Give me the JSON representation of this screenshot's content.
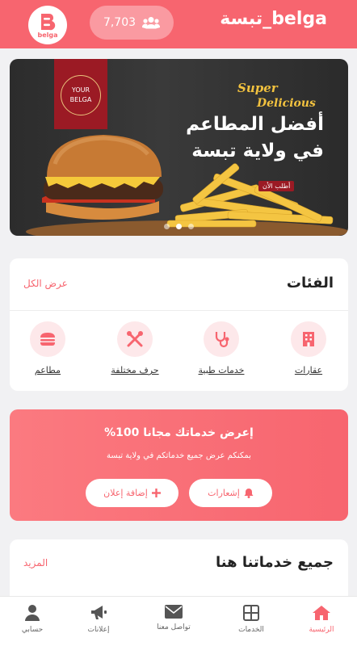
{
  "header": {
    "title": "belga_تبسة",
    "users_count": "7,703",
    "logo_text": "belga",
    "users_icon": "users-icon",
    "brand_color": "#f7656f"
  },
  "banner": {
    "badge_line1": "YOUR",
    "badge_line2": "BELGA",
    "super": "Super",
    "delicious": "Delicious",
    "headline_line1": "أفضل المطاعم",
    "headline_line2": "في ولاية تبسة",
    "order_tag": "أطلب الأن",
    "slide_index": 1,
    "slide_count": 3
  },
  "categories": {
    "title": "الفئات",
    "view_all": "عرض الكل",
    "items": [
      {
        "label": "عقارات",
        "icon": "building-icon"
      },
      {
        "label": "خدمات طبية",
        "icon": "stethoscope-icon"
      },
      {
        "label": "حرف مختلفة",
        "icon": "tools-icon"
      },
      {
        "label": "مطاعم",
        "icon": "burger-icon"
      }
    ]
  },
  "promo": {
    "title": "إعرض خدماتك مجانا 100%",
    "subtitle": "بمكنكم عرض جميع خدماتكم في ولاية تبسة",
    "notify_label": "إشعارات",
    "add_label": "إضافة إعلان"
  },
  "services": {
    "title": "جميع خدماتنا هنا",
    "more": "المزيد"
  },
  "nav": {
    "items": [
      {
        "label": "الرئيسية",
        "icon": "home-icon",
        "active": true
      },
      {
        "label": "الخدمات",
        "icon": "grid-icon",
        "active": false
      },
      {
        "label": "تواصل معنا",
        "icon": "envelope-icon",
        "active": false
      },
      {
        "label": "إعلانات",
        "icon": "megaphone-icon",
        "active": false
      },
      {
        "label": "حسابي",
        "icon": "user-icon",
        "active": false
      }
    ]
  }
}
